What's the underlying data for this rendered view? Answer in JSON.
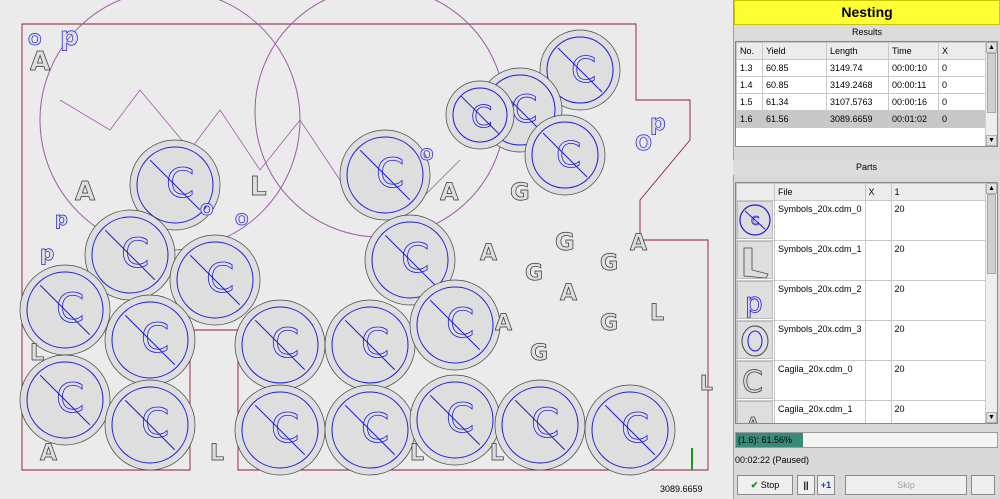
{
  "panel": {
    "title": "Nesting"
  },
  "results": {
    "header": "Results",
    "columns": [
      "No.",
      "Yield",
      "Length",
      "Time",
      "X"
    ],
    "rows": [
      [
        "1.3",
        "60.85",
        "3149.74",
        "00:00:10",
        "0"
      ],
      [
        "1.4",
        "60.85",
        "3149.2468",
        "00:00:11",
        "0"
      ],
      [
        "1.5",
        "61.34",
        "3107.5763",
        "00:00:16",
        "0"
      ],
      [
        "1.6",
        "61.56",
        "3089.6659",
        "00:01:02",
        "0"
      ]
    ],
    "selected_row": 3
  },
  "parts": {
    "header": "Parts",
    "columns": [
      "",
      "File",
      "X",
      "1"
    ],
    "rows": [
      {
        "icon": "no-symbol-icon",
        "file": "Symbols_20x.cdm_0",
        "x": "",
        "count": "20"
      },
      {
        "icon": "letter-l-icon",
        "file": "Symbols_20x.cdm_1",
        "x": "",
        "count": "20"
      },
      {
        "icon": "letter-p-icon",
        "file": "Symbols_20x.cdm_2",
        "x": "",
        "count": "20"
      },
      {
        "icon": "letter-o-icon",
        "file": "Symbols_20x.cdm_3",
        "x": "",
        "count": "20"
      },
      {
        "icon": "letter-c-icon",
        "file": "Cagila_20x.cdm_0",
        "x": "",
        "count": "20"
      },
      {
        "icon": "letter-a-icon",
        "file": "Cagila_20x.cdm_1",
        "x": "",
        "count": "20"
      }
    ]
  },
  "status": {
    "text": "(1.6): 61.56%",
    "progress": 0.6156,
    "time": "00:02:22 (Paused)"
  },
  "controls": {
    "stop": "Stop",
    "pause": "||",
    "plus_one": "+1",
    "skip": "Skip"
  },
  "canvas": {
    "length_readout": "3089.6659"
  },
  "colors": {
    "title_bg": "#ffff33",
    "accent_outline": "#8b1a3a",
    "symbol_blue": "#1a1adc",
    "progress": "#3a8a78"
  }
}
